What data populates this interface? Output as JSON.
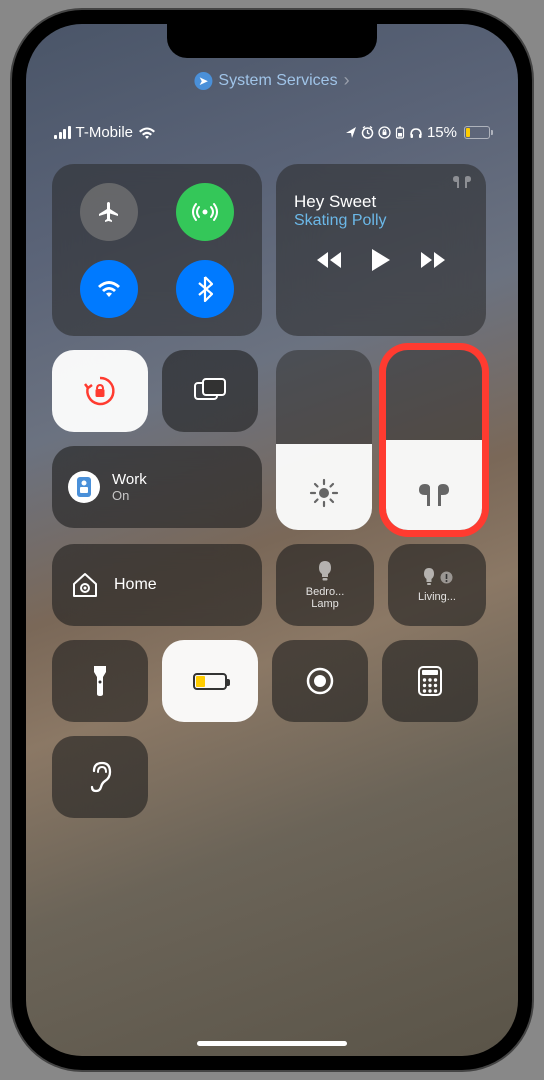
{
  "banner": {
    "text": "System Services"
  },
  "status": {
    "carrier": "T-Mobile",
    "battery_pct": "15%"
  },
  "media": {
    "title": "Hey Sweet",
    "artist": "Skating Polly"
  },
  "focus": {
    "label": "Work",
    "status": "On"
  },
  "brightness": {
    "level": 48
  },
  "volume": {
    "level": 50
  },
  "home": {
    "label": "Home",
    "room1": "Bedro...",
    "room1_sub": "Lamp",
    "room2": "Living..."
  }
}
